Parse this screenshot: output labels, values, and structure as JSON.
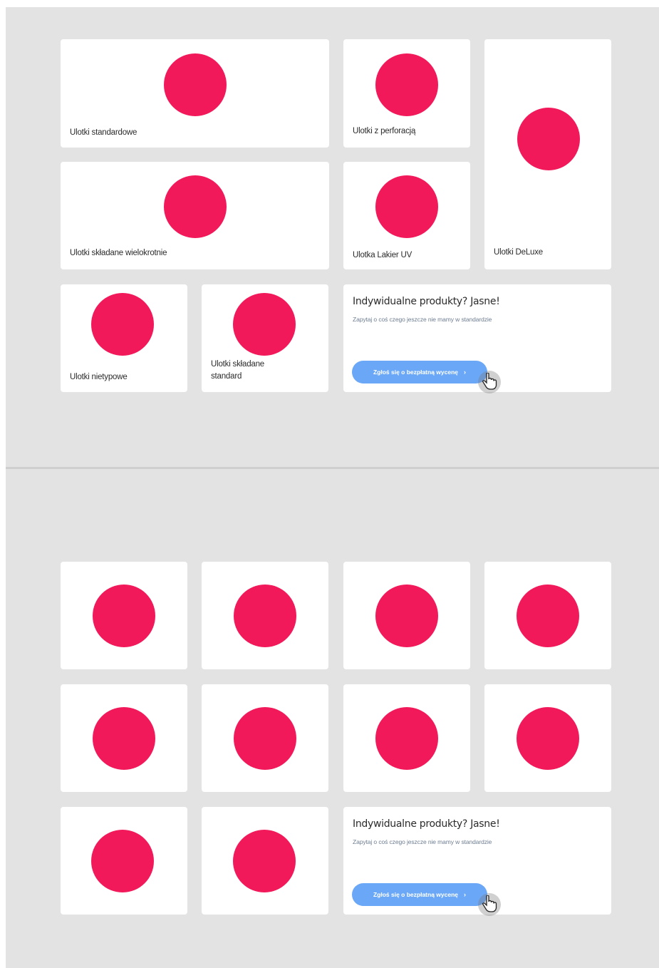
{
  "section_top": {
    "products": [
      {
        "label": "Ulotki standardowe"
      },
      {
        "label": "Ulotki z perforacją"
      },
      {
        "label": "Ulotki DeLuxe"
      },
      {
        "label": "Ulotki składane wielokrotnie"
      },
      {
        "label": "Ulotka Lakier UV"
      },
      {
        "label": "Ulotki nietypowe"
      },
      {
        "label": "Ulotki składane standard"
      }
    ],
    "promo": {
      "title": "Indywidualne produkty? Jasne!",
      "subtitle": "Zapytaj o coś czego jeszcze nie mamy w standardzie",
      "button_label": "Zgłoś się o bezpłatną wycenę",
      "button_arrow": "›"
    }
  },
  "section_bottom": {
    "tile_count_visible": 10,
    "promo": {
      "title": "Indywidualne produkty? Jasne!",
      "subtitle": "Zapytaj o coś czego jeszcze nie mamy w standardzie",
      "button_label": "Zgłoś się o bezpłatną wycenę",
      "button_arrow": "›"
    }
  },
  "colors": {
    "background": "#e3e3e3",
    "card": "#ffffff",
    "dot": "#f2195a",
    "button": "#6aa8f7"
  },
  "icons": {
    "product_image": "placeholder-circle-icon",
    "cursor": "hand-pointer-icon"
  }
}
